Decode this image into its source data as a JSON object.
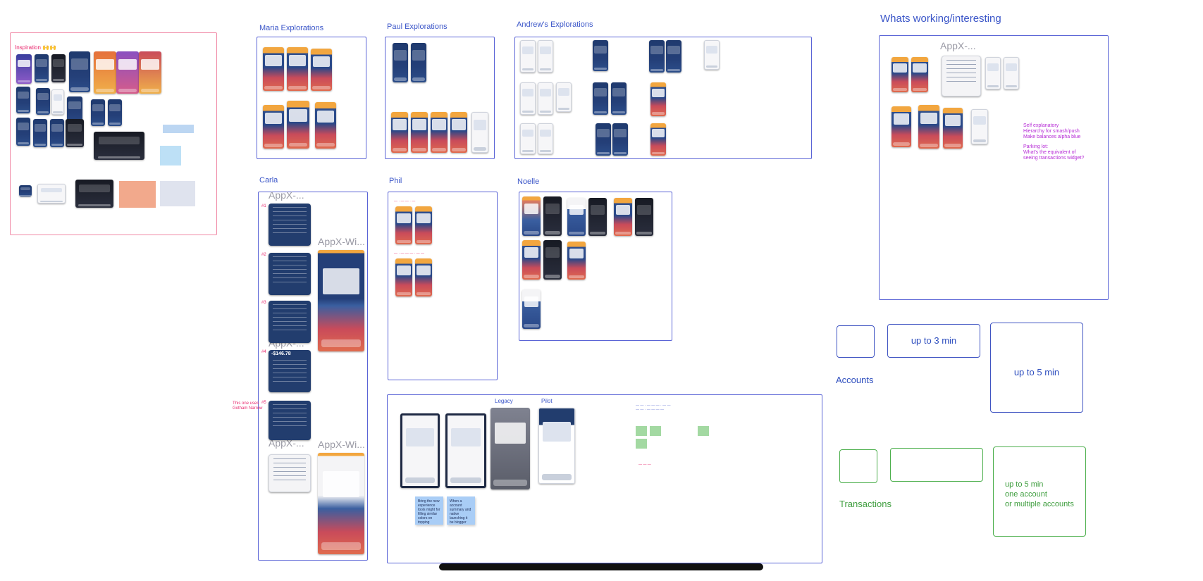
{
  "board": {
    "inspiration": {
      "title": "Inspiration 🙌🙌"
    },
    "maria": {
      "title": "Maria Explorations"
    },
    "paul": {
      "title": "Paul Explorations"
    },
    "andrew": {
      "title": "Andrew's Explorations"
    },
    "whats_working": {
      "title": "Whats working/interesting",
      "widget_ghost": "AppX-...",
      "notes": [
        "Self explanatory",
        "Hierarchy for smash/push",
        "Make balances alpha blue",
        "",
        "Parking lot:",
        "What's the equivalent of",
        "seeing transactions widget?"
      ]
    },
    "carla": {
      "title": "Carla",
      "ghost_top": "AppX-...",
      "ghost_wide_1": "AppX-Wi...",
      "ghost_wide_2": "AppX-Wi...",
      "ghost_mid": "AppX-...",
      "ghost_low": "AppX-...",
      "numbers": [
        "#1",
        "#2",
        "#3",
        "#4",
        "#5"
      ],
      "big_balance": "-$146.78",
      "side_note_1": "This one uses",
      "side_note_2": "Gotham Narrow"
    },
    "phil": {
      "title": "Phil"
    },
    "noelle": {
      "title": "Noelle"
    },
    "legacy_pilot": {
      "legacy": "Legacy",
      "pilot": "Pilot",
      "sticky_1": "Bring the new experience tools might for filling similar colors on topping",
      "sticky_2": "When a account summary and native launching it be blogger"
    },
    "accounts": {
      "label": "Accounts",
      "box_2": "up to 3 min",
      "box_3": "up to 5 min"
    },
    "transactions": {
      "label": "Transactions",
      "box_3_line1": "up to 5 min",
      "box_3_line2": "one account",
      "box_3_line3": "or multiple accounts"
    }
  }
}
